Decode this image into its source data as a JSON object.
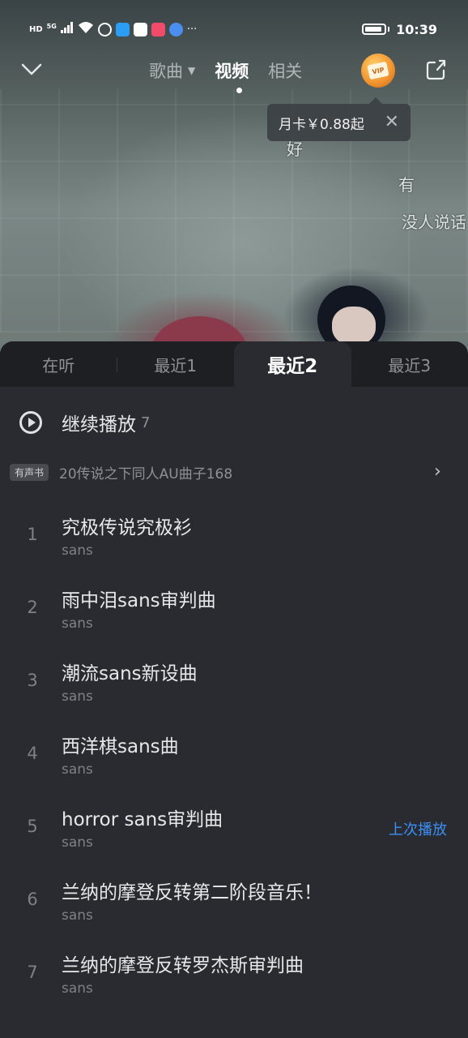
{
  "status_bar": {
    "left_labels": [
      "HD",
      "5G"
    ],
    "more": "···",
    "time": "10:39"
  },
  "video": {
    "danmaku": [
      "好",
      "有",
      "没人说话"
    ]
  },
  "nav": {
    "tabs": [
      {
        "label": "歌曲",
        "active": false
      },
      {
        "label": "视频",
        "active": true
      },
      {
        "label": "相关",
        "active": false
      }
    ],
    "vip_label": "VIP"
  },
  "promo": {
    "text": "月卡￥0.88起",
    "close": "✕"
  },
  "sheet": {
    "tabs": [
      {
        "label": "在听",
        "active": false
      },
      {
        "label": "最近1",
        "active": false
      },
      {
        "label": "最近2",
        "active": true
      },
      {
        "label": "最近3",
        "active": false
      }
    ],
    "continue": {
      "label": "继续播放",
      "count": "7"
    },
    "album": {
      "badge": "有声书",
      "title": "20传说之下同人AU曲子168",
      "chevron": "›"
    },
    "tracks": [
      {
        "index": "1",
        "title": "究极传说究极衫",
        "artist": "sans"
      },
      {
        "index": "2",
        "title": "雨中泪sans审判曲",
        "artist": "sans"
      },
      {
        "index": "3",
        "title": "潮流sans新设曲",
        "artist": "sans"
      },
      {
        "index": "4",
        "title": "西洋棋sans曲",
        "artist": "sans"
      },
      {
        "index": "5",
        "title": "horror sans审判曲",
        "artist": "sans",
        "tag": "上次播放"
      },
      {
        "index": "6",
        "title": "兰纳的摩登反转第二阶段音乐！",
        "artist": "sans"
      },
      {
        "index": "7",
        "title": "兰纳的摩登反转罗杰斯审判曲",
        "artist": "sans"
      }
    ]
  },
  "colors": {
    "accent": "#3b8ff5",
    "sheet_bg": "#2a2b30",
    "tab_bar_bg": "#1e1f23"
  }
}
